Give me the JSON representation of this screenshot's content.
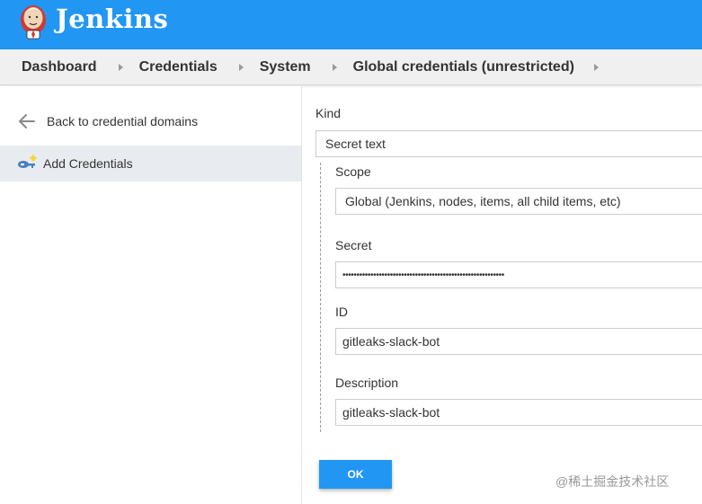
{
  "header": {
    "brand": "Jenkins",
    "logo_icon": "jenkins-butler-logo",
    "background_color": "#2196f3"
  },
  "breadcrumb": {
    "items": [
      "Dashboard",
      "Credentials",
      "System",
      "Global credentials (unrestricted)"
    ]
  },
  "sidebar": {
    "back_label": "Back to credential domains",
    "back_icon": "arrow-left-icon",
    "add_label": "Add Credentials",
    "add_icon": "credentials-key-icon"
  },
  "form": {
    "kind_label": "Kind",
    "kind_value": "Secret text",
    "scope_label": "Scope",
    "scope_value": "Global (Jenkins, nodes, items, all child items, etc)",
    "secret_label": "Secret",
    "secret_value": "••••••••••••••••••••••••••••••••••••••••••••••••••••••••••",
    "id_label": "ID",
    "id_value": "gitleaks-slack-bot",
    "description_label": "Description",
    "description_value": "gitleaks-slack-bot",
    "ok_label": "OK"
  },
  "watermark": "@稀土掘金技术社区"
}
